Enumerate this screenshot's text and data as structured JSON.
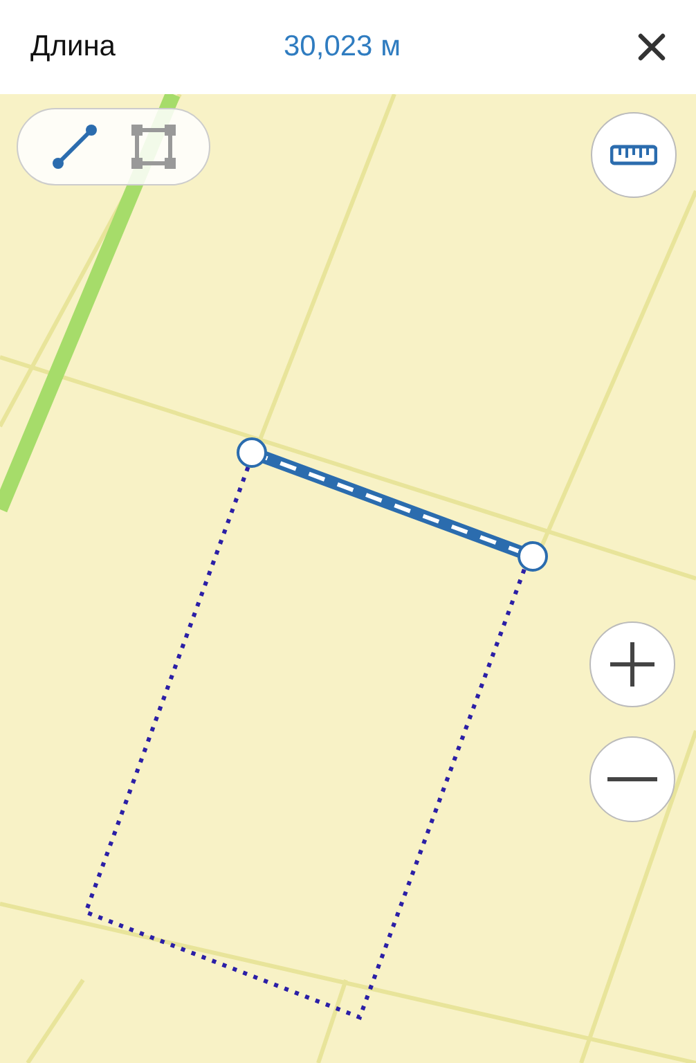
{
  "header": {
    "label": "Длина",
    "value": "30,023 м"
  },
  "tools": [
    {
      "kind": "line",
      "selected": true
    },
    {
      "kind": "polygon",
      "selected": false
    }
  ]
}
